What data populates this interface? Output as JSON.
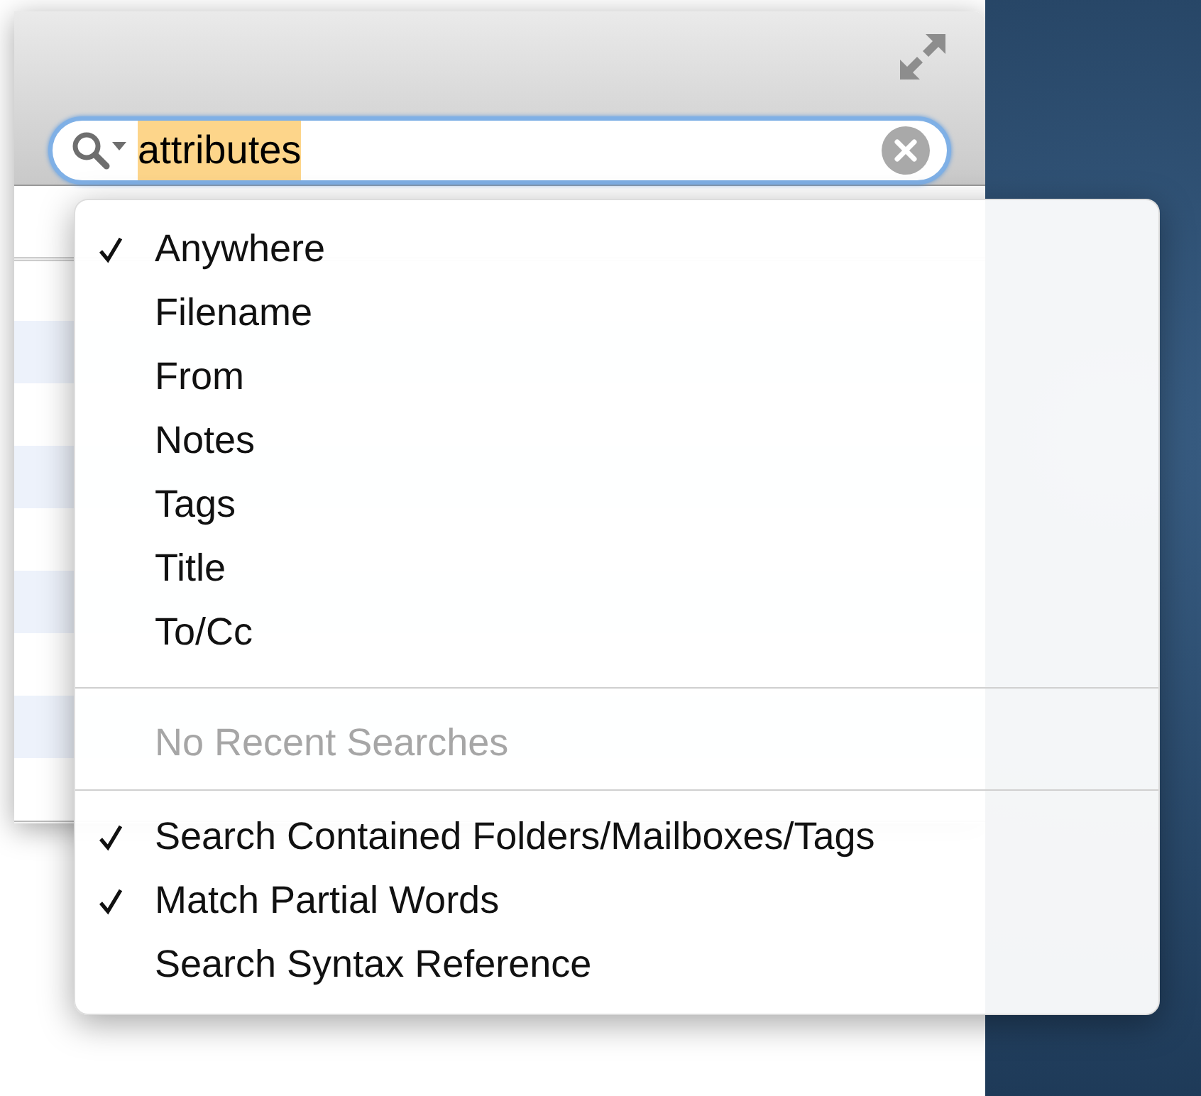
{
  "search": {
    "value": "attributes",
    "text_selected": true
  },
  "menu": {
    "scopes": [
      {
        "label": "Anywhere",
        "checked": true
      },
      {
        "label": "Filename",
        "checked": false
      },
      {
        "label": "From",
        "checked": false
      },
      {
        "label": "Notes",
        "checked": false
      },
      {
        "label": "Tags",
        "checked": false
      },
      {
        "label": "Title",
        "checked": false
      },
      {
        "label": "To/Cc",
        "checked": false
      }
    ],
    "recent": [
      {
        "label": "No Recent Searches",
        "disabled": true
      }
    ],
    "options": [
      {
        "label": "Search Contained Folders/Mailboxes/Tags",
        "checked": true
      },
      {
        "label": "Match Partial Words",
        "checked": true
      },
      {
        "label": "Search Syntax Reference",
        "checked": false
      }
    ]
  }
}
